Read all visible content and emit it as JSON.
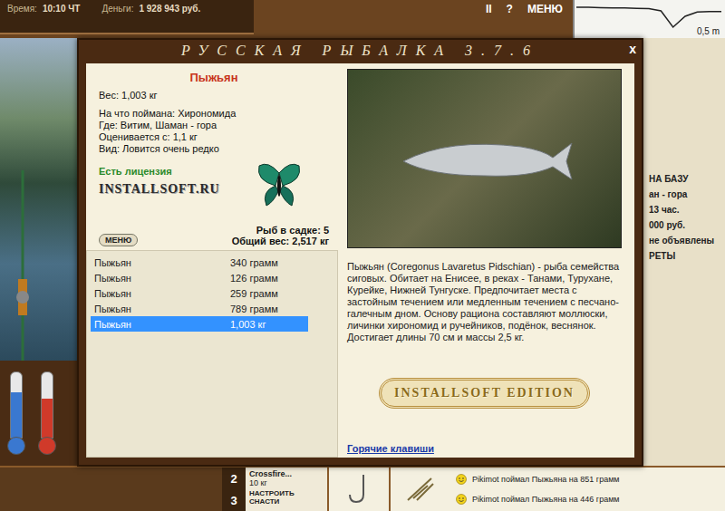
{
  "hud": {
    "time_label": "Время:",
    "time": "10:10 ЧТ",
    "money_label": "Деньги:",
    "money": "1 928 943 руб.",
    "buttons": [
      "II",
      "?",
      "МЕНЮ"
    ],
    "depth": "0,5 m",
    "depth_profile": [
      0.2,
      0.2,
      0.21,
      0.22,
      0.22,
      0.23,
      0.24,
      0.3,
      0.75,
      0.45,
      0.33,
      0.32,
      0.32
    ]
  },
  "side_panel": {
    "lines": [
      "НА БАЗУ",
      "ан - гора",
      "13 час.",
      "000 руб.",
      "не объявлены",
      "РЕТЫ"
    ]
  },
  "thermometers": [
    {
      "level": 0.7,
      "color": "#3a78d0"
    },
    {
      "level": 0.6,
      "color": "#d03a2a"
    }
  ],
  "modal": {
    "title": "РУССКАЯ РЫБАЛКА 3.7.6",
    "close": "x"
  },
  "fish": {
    "name": "Пыжьян",
    "weight": "Вес: 1,003 кг",
    "details": [
      "На что поймана: Хирономида",
      "Где: Витим, Шаман - гора",
      "Оценивается с: 1,1 кг",
      "Вид: Ловится очень редко"
    ]
  },
  "license": "Есть лицензия",
  "logo": "INSTALLSOFT.RU",
  "menu_button": "МЕНЮ",
  "count": "Рыб в садке: 5",
  "total": "Общий вес: 2,517 кг",
  "catch_list": [
    {
      "name": "Пыжьян",
      "weight": "340 грамм",
      "selected": false
    },
    {
      "name": "Пыжьян",
      "weight": "126 грамм",
      "selected": false
    },
    {
      "name": "Пыжьян",
      "weight": "259 грамм",
      "selected": false
    },
    {
      "name": "Пыжьян",
      "weight": "789 грамм",
      "selected": false
    },
    {
      "name": "Пыжьян",
      "weight": "1,003 кг",
      "selected": true
    }
  ],
  "description": "Пыжьян (Coregonus Lavaretus Pidschian) - рыба семейства сиговых. Обитает на Енисее, в реках - Танами, Турухане, Курейке, Нижней Тунгуске. Предпочитает места с застойным течением или медленным течением с песчано-галечным дном. Основу рациона составляют моллюски, личинки хирономид и ручейников, подёнок, веснянок. Достигает длины 70 см и массы 2,5 кг.",
  "edition": "INSTALLSOFT EDITION",
  "hotkeys_link": "Горячие клавиши",
  "bottom": {
    "slots": [
      "2",
      "3"
    ],
    "tackle": "Crossfire...",
    "tackle_weight": "10 кг",
    "setup_button": "НАСТРОИТЬ СНАСТИ"
  },
  "chat": [
    {
      "text": "Pikimot поймал Пыжьяна на 851 грамм"
    },
    {
      "text": "Pikimot поймал Пыжьяна на 446 грамм"
    }
  ]
}
